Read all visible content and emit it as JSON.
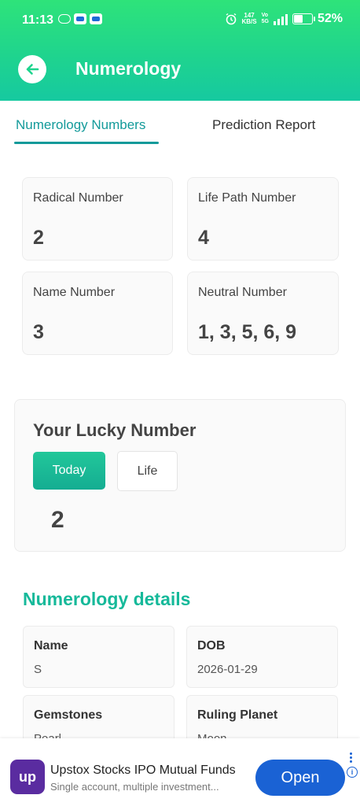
{
  "status_bar": {
    "time": "11:13",
    "net_speed_top": "147",
    "net_speed_bottom": "KB/S",
    "volte_top": "Vo",
    "volte_bottom": "5G",
    "signal_label": "5G",
    "battery_pct": "52%",
    "battery_level": 0.52,
    "icons": [
      "group-icon",
      "app-icon",
      "app-icon",
      "alarm-icon",
      "signal-icon",
      "battery-charging-icon"
    ]
  },
  "header": {
    "title": "Numerology",
    "back_icon": "arrow-left-icon",
    "accent_color": "#1fd48e"
  },
  "tabs": [
    {
      "label": "Numerology Numbers",
      "active": true
    },
    {
      "label": "Prediction Report",
      "active": false
    }
  ],
  "numbers": [
    {
      "label": "Radical Number",
      "value": "2"
    },
    {
      "label": "Life Path Number",
      "value": "4"
    },
    {
      "label": "Name Number",
      "value": "3"
    },
    {
      "label": "Neutral Number",
      "value": "1, 3, 5, 6, 9"
    }
  ],
  "lucky": {
    "title": "Your Lucky Number",
    "today_label": "Today",
    "life_label": "Life",
    "value": "2"
  },
  "details": {
    "title": "Numerology details",
    "items": [
      {
        "label": "Name",
        "value": "S"
      },
      {
        "label": "DOB",
        "value": "2026-01-29"
      },
      {
        "label": "Gemstones",
        "value": "Pearl"
      },
      {
        "label": "Ruling Planet",
        "value": "Moon"
      }
    ]
  },
  "ad": {
    "logo_text": "up",
    "title": "Upstox Stocks IPO Mutual Funds",
    "subtitle": "Single account, multiple investment...",
    "button_label": "Open",
    "info_glyph": "i",
    "brand_color": "#5a2ca0",
    "button_color": "#1a62d4"
  }
}
